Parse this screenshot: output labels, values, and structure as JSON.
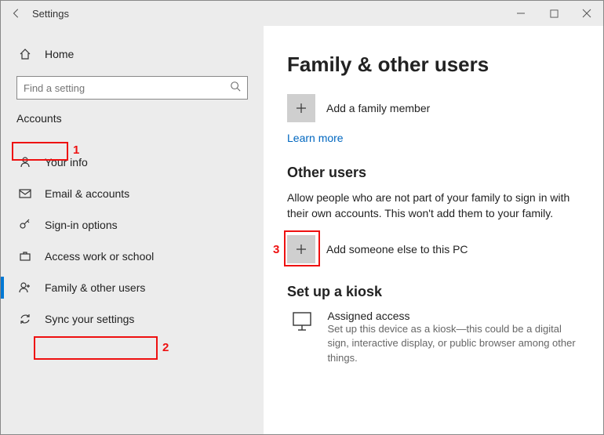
{
  "titlebar": {
    "title": "Settings"
  },
  "sidebar": {
    "home": "Home",
    "search_placeholder": "Find a setting",
    "category": "Accounts",
    "items": [
      {
        "label": "Your info"
      },
      {
        "label": "Email & accounts"
      },
      {
        "label": "Sign-in options"
      },
      {
        "label": "Access work or school"
      },
      {
        "label": "Family & other users"
      },
      {
        "label": "Sync your settings"
      }
    ]
  },
  "main": {
    "heading": "Family & other users",
    "add_family_label": "Add a family member",
    "learn_more": "Learn more",
    "other_users_heading": "Other users",
    "other_users_desc": "Allow people who are not part of your family to sign in with their own accounts. This won't add them to your family.",
    "add_other_label": "Add someone else to this PC",
    "kiosk_heading": "Set up a kiosk",
    "kiosk_title": "Assigned access",
    "kiosk_sub": "Set up this device as a kiosk—this could be a digital sign, interactive display, or public browser among other things."
  },
  "annotations": {
    "n1": "1",
    "n2": "2",
    "n3": "3"
  }
}
